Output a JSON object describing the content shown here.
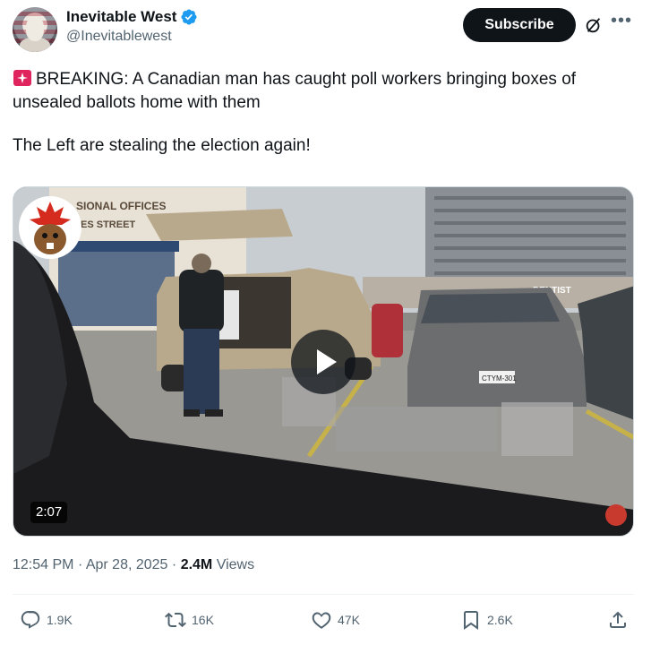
{
  "author": {
    "display_name": "Inevitable West",
    "handle": "@Inevitablewest",
    "verified": true
  },
  "header": {
    "subscribe_label": "Subscribe"
  },
  "tweet": {
    "line1": "BREAKING: A Canadian man has caught poll workers bringing boxes of unsealed ballots home with them",
    "line2": "The Left are stealing the election again!",
    "emoji": "siren-icon"
  },
  "media": {
    "duration": "2:07",
    "store_sign_1": "SIONAL OFFICES",
    "store_sign_2": "ES STREET",
    "dentist_sign": "DENTIST",
    "plate": "CTYM-301"
  },
  "meta": {
    "time": "12:54 PM",
    "date": "Apr 28, 2025",
    "views_count": "2.4M",
    "views_label": "Views"
  },
  "actions": {
    "replies": "1.9K",
    "reposts": "16K",
    "likes": "47K",
    "bookmarks": "2.6K"
  },
  "colors": {
    "text": "#0f1419",
    "secondary": "#536471",
    "verified": "#1d9bf0",
    "button": "#0f1419"
  }
}
